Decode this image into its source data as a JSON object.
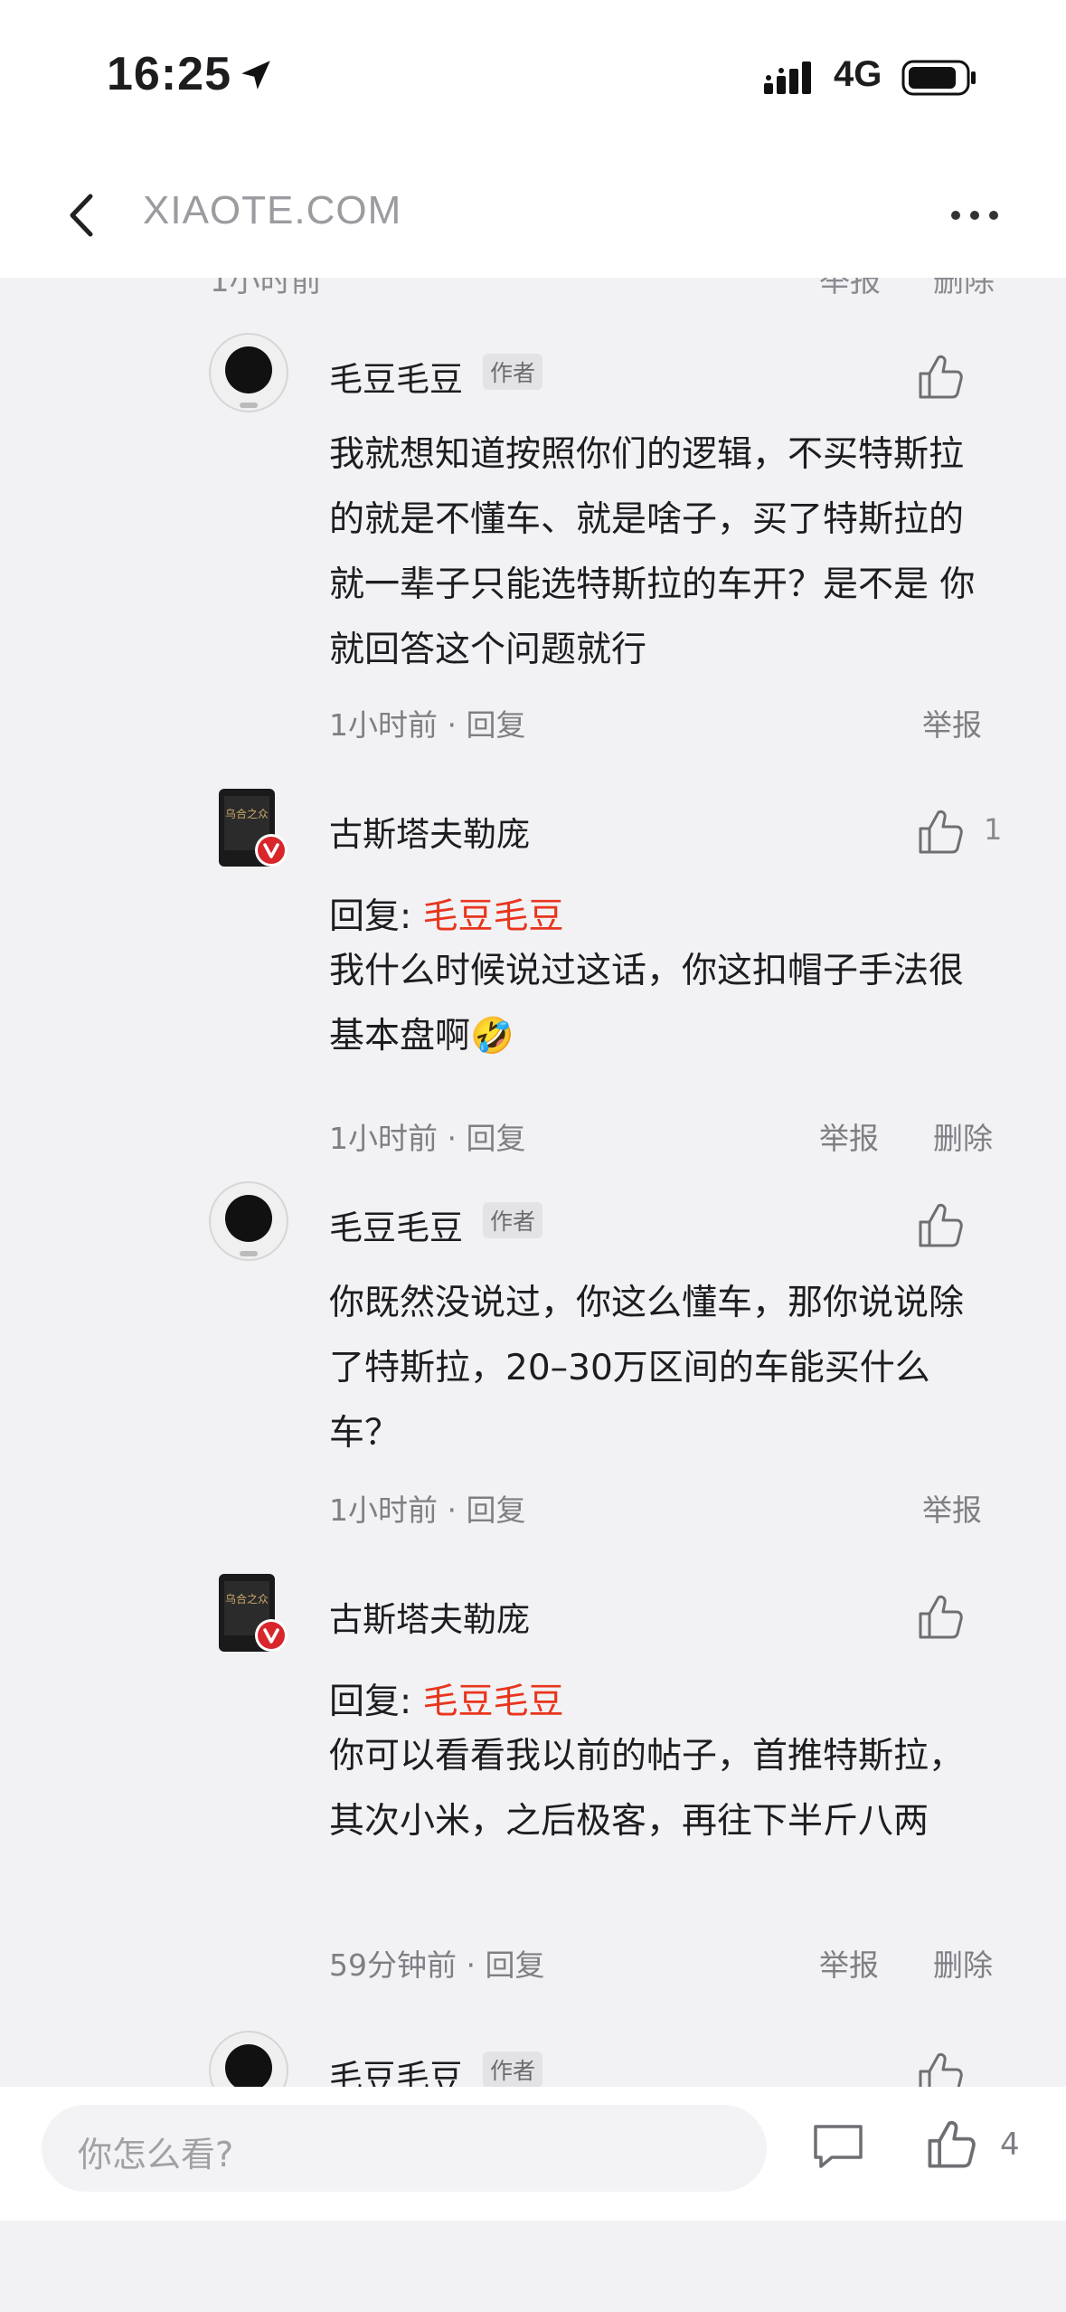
{
  "status_bar": {
    "time": "16:25",
    "network": "4G"
  },
  "nav": {
    "title": "XIAOTE.COM"
  },
  "partial_top": {
    "left": "1小时前",
    "report": "举报",
    "delete": "删除"
  },
  "comments": [
    {
      "user": "毛豆毛豆",
      "tag": "作者",
      "body": "我就想知道按照你们的逻辑，不买特斯拉的就是不懂车、就是啥子，买了特斯拉的就一辈子只能选特斯拉的车开？是不是 你就回答这个问题就行",
      "time": "1小时前",
      "reply": "回复",
      "report": "举报"
    },
    {
      "user": "古斯塔夫勒庞",
      "likes": "1",
      "reply_prefix": "回复: ",
      "reply_to": "毛豆毛豆",
      "body": "我什么时候说过这话，你这扣帽子手法很基本盘啊🤣",
      "time": "1小时前",
      "reply": "回复",
      "report": "举报",
      "delete": "删除"
    },
    {
      "user": "毛豆毛豆",
      "tag": "作者",
      "body": "你既然没说过，你这么懂车，那你说说除了特斯拉，20–30万区间的车能买什么车？",
      "time": "1小时前",
      "reply": "回复",
      "report": "举报"
    },
    {
      "user": "古斯塔夫勒庞",
      "reply_prefix": "回复: ",
      "reply_to": "毛豆毛豆",
      "body": "你可以看看我以前的帖子，首推特斯拉，其次小米，之后极客，再往下半斤八两",
      "time": "59分钟前",
      "reply": "回复",
      "report": "举报",
      "delete": "删除"
    },
    {
      "user": "毛豆毛豆",
      "tag": "作者"
    }
  ],
  "bottom_bar": {
    "placeholder": "你怎么看?",
    "like_count": "4"
  },
  "colors": {
    "accent_red": "#e8351e",
    "meta_gray": "#7e7e84"
  },
  "icons": [
    "back-icon",
    "more-icon",
    "thumb-up-icon",
    "chat-icon",
    "location-arrow-icon",
    "signal-icon",
    "battery-icon"
  ]
}
